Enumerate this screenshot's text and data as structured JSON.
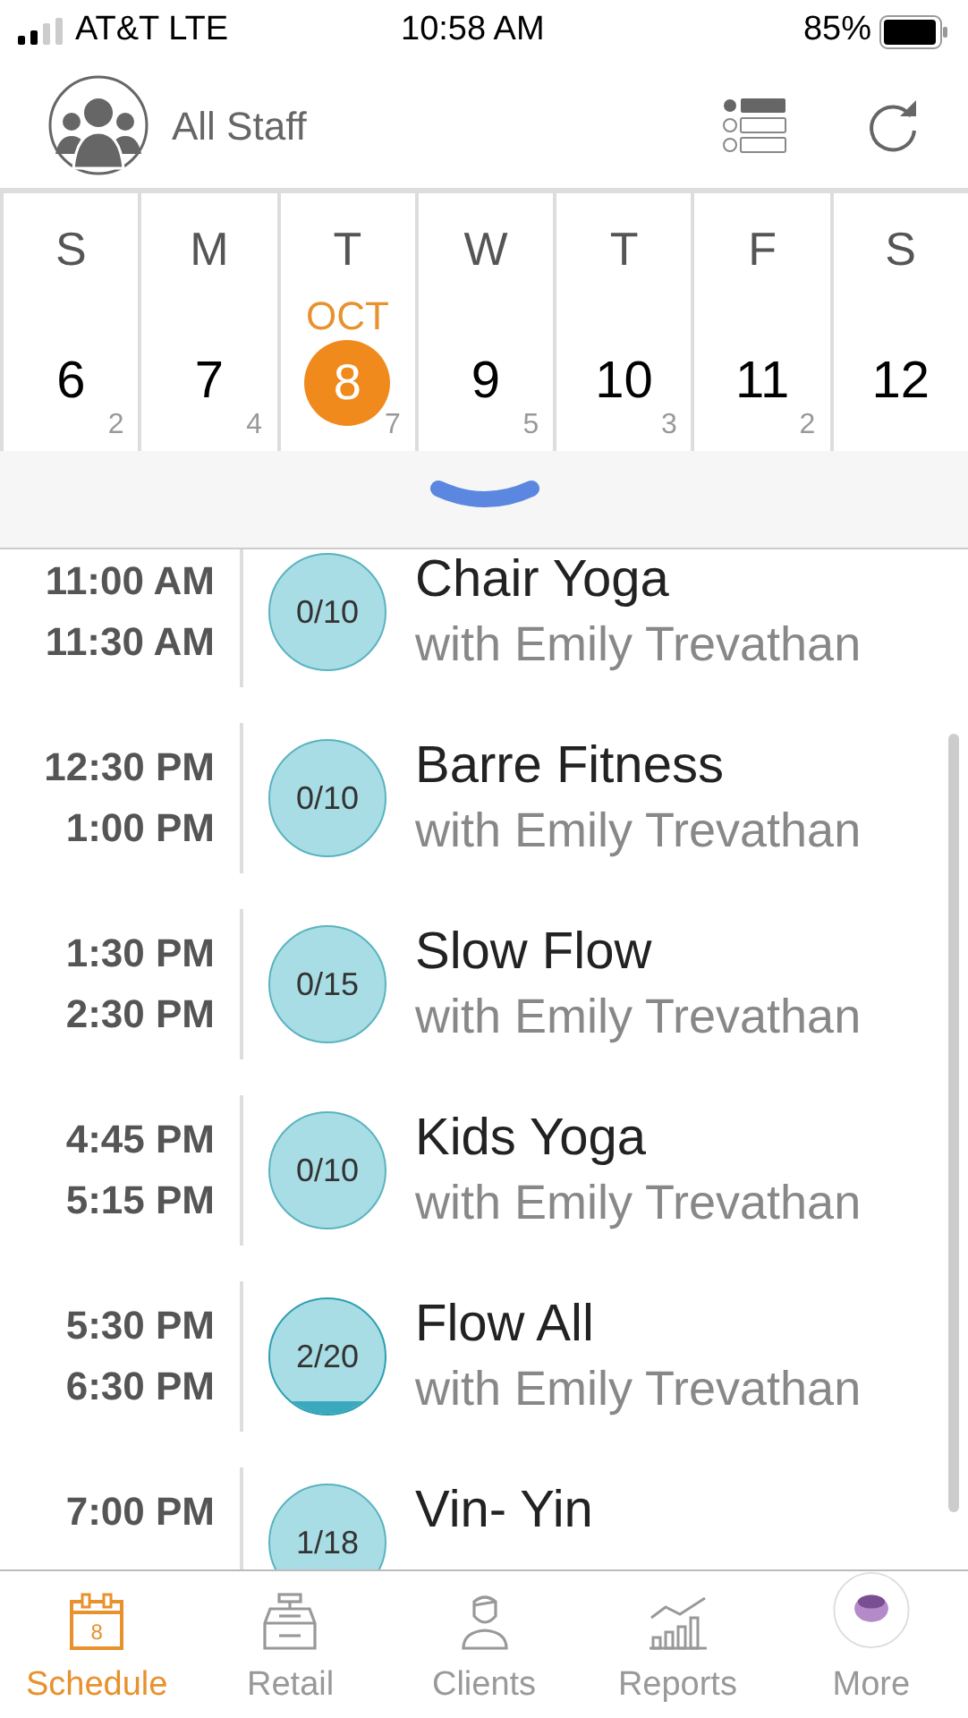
{
  "status_bar": {
    "carrier": "AT&T LTE",
    "time": "10:58 AM",
    "battery": "85%"
  },
  "header": {
    "title": "All Staff"
  },
  "week": {
    "month": "OCT",
    "days": [
      {
        "weekday": "S",
        "date": "6",
        "count": "2",
        "selected": false
      },
      {
        "weekday": "M",
        "date": "7",
        "count": "4",
        "selected": false
      },
      {
        "weekday": "T",
        "date": "8",
        "count": "7",
        "selected": true
      },
      {
        "weekday": "W",
        "date": "9",
        "count": "5",
        "selected": false
      },
      {
        "weekday": "T",
        "date": "10",
        "count": "3",
        "selected": false
      },
      {
        "weekday": "F",
        "date": "11",
        "count": "2",
        "selected": false
      },
      {
        "weekday": "S",
        "date": "12",
        "selected": false
      }
    ]
  },
  "classes": [
    {
      "start": "11:00 AM",
      "end": "11:30 AM",
      "booked": "0/10",
      "fill_shown": false,
      "name": "Chair Yoga",
      "instructor": "with Emily Trevathan"
    },
    {
      "start": "12:30 PM",
      "end": "1:00 PM",
      "booked": "0/10",
      "fill_shown": false,
      "name": "Barre Fitness",
      "instructor": "with Emily Trevathan"
    },
    {
      "start": "1:30 PM",
      "end": "2:30 PM",
      "booked": "0/15",
      "fill_shown": false,
      "name": "Slow Flow",
      "instructor": "with Emily Trevathan"
    },
    {
      "start": "4:45 PM",
      "end": "5:15 PM",
      "booked": "0/10",
      "fill_shown": false,
      "name": "Kids Yoga",
      "instructor": "with Emily Trevathan"
    },
    {
      "start": "5:30 PM",
      "end": "6:30 PM",
      "booked": "2/20",
      "fill_shown": true,
      "name": "Flow All",
      "instructor": "with Emily Trevathan"
    },
    {
      "start": "7:00 PM",
      "booked": "1/18",
      "fill_shown": false,
      "name": "Vin- Yin"
    }
  ],
  "tab_bar": [
    {
      "label": "Schedule",
      "kind": "calendar",
      "badge": "8",
      "selected": true
    },
    {
      "label": "Retail",
      "kind": "register",
      "selected": false
    },
    {
      "label": "Clients",
      "kind": "person",
      "selected": false
    },
    {
      "label": "Reports",
      "kind": "chart",
      "selected": false
    },
    {
      "label": "More",
      "kind": "avatar",
      "selected": false
    }
  ]
}
